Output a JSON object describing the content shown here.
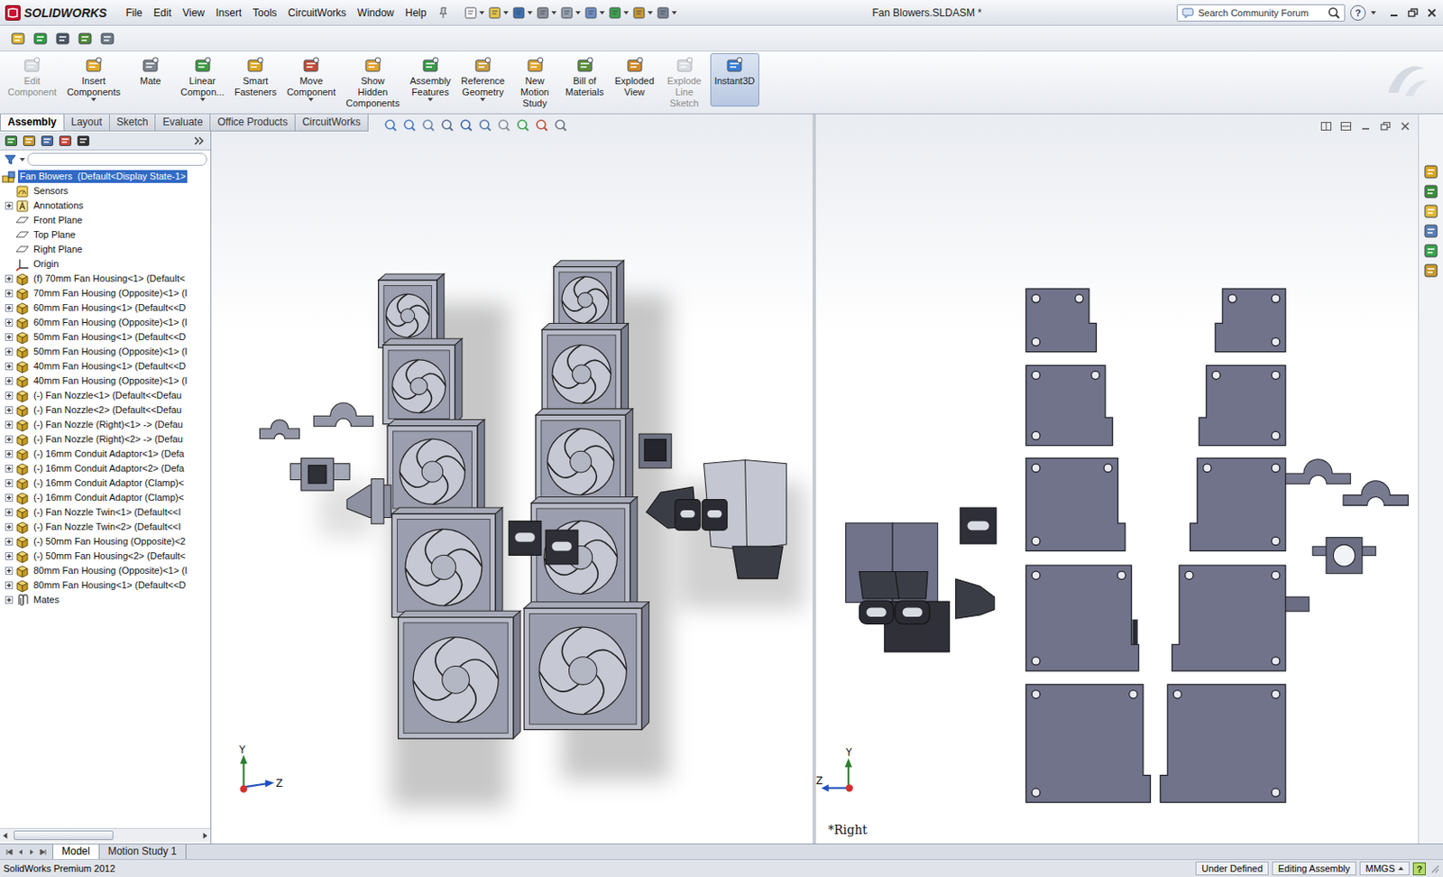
{
  "app": {
    "logo": "SOLIDWORKS",
    "title": "Fan Blowers.SLDASM *"
  },
  "menus": [
    "File",
    "Edit",
    "View",
    "Insert",
    "Tools",
    "CircuitWorks",
    "Window",
    "Help"
  ],
  "search": {
    "placeholder": "Search Community Forum"
  },
  "help": "?",
  "ribbon": [
    {
      "lines": [
        "Edit",
        "Component"
      ],
      "disabled": true,
      "selected": false,
      "dropdown": false
    },
    {
      "lines": [
        "Insert",
        "Components"
      ],
      "disabled": false,
      "selected": false,
      "dropdown": true
    },
    {
      "lines": [
        "Mate"
      ],
      "disabled": false,
      "selected": false,
      "dropdown": false
    },
    {
      "lines": [
        "Linear",
        "Compon..."
      ],
      "disabled": false,
      "selected": false,
      "dropdown": true
    },
    {
      "lines": [
        "Smart",
        "Fasteners"
      ],
      "disabled": false,
      "selected": false,
      "dropdown": false
    },
    {
      "lines": [
        "Move",
        "Component"
      ],
      "disabled": false,
      "selected": false,
      "dropdown": true
    },
    {
      "lines": [
        "Show",
        "Hidden",
        "Components"
      ],
      "disabled": false,
      "selected": false,
      "dropdown": false
    },
    {
      "lines": [
        "Assembly",
        "Features"
      ],
      "disabled": false,
      "selected": false,
      "dropdown": true
    },
    {
      "lines": [
        "Reference",
        "Geometry"
      ],
      "disabled": false,
      "selected": false,
      "dropdown": true
    },
    {
      "lines": [
        "New",
        "Motion",
        "Study"
      ],
      "disabled": false,
      "selected": false,
      "dropdown": false
    },
    {
      "lines": [
        "Bill of",
        "Materials"
      ],
      "disabled": false,
      "selected": false,
      "dropdown": false
    },
    {
      "lines": [
        "Exploded",
        "View"
      ],
      "disabled": false,
      "selected": false,
      "dropdown": false
    },
    {
      "lines": [
        "Explode",
        "Line",
        "Sketch"
      ],
      "disabled": true,
      "selected": false,
      "dropdown": false
    },
    {
      "lines": [
        "Instant3D"
      ],
      "disabled": false,
      "selected": true,
      "dropdown": false
    }
  ],
  "tabs": [
    {
      "label": "Assembly",
      "selected": true
    },
    {
      "label": "Layout",
      "selected": false
    },
    {
      "label": "Sketch",
      "selected": false
    },
    {
      "label": "Evaluate",
      "selected": false
    },
    {
      "label": "Office Products",
      "selected": false
    },
    {
      "label": "CircuitWorks",
      "selected": false
    }
  ],
  "tree": [
    {
      "label": "Fan Blowers  (Default<Display State-1>",
      "kind": "assembly",
      "expandable": false,
      "selected": true
    },
    {
      "label": "Sensors",
      "kind": "sensors",
      "expandable": false,
      "selected": false
    },
    {
      "label": "Annotations",
      "kind": "annotations",
      "expandable": true,
      "selected": false
    },
    {
      "label": "Front Plane",
      "kind": "plane",
      "expandable": false,
      "selected": false
    },
    {
      "label": "Top Plane",
      "kind": "plane",
      "expandable": false,
      "selected": false
    },
    {
      "label": "Right Plane",
      "kind": "plane",
      "expandable": false,
      "selected": false
    },
    {
      "label": "Origin",
      "kind": "origin",
      "expandable": false,
      "selected": false
    },
    {
      "label": "(f) 70mm Fan Housing<1> (Default<",
      "kind": "part",
      "expandable": true,
      "selected": false
    },
    {
      "label": "70mm Fan Housing (Opposite)<1> (I",
      "kind": "part",
      "expandable": true,
      "selected": false
    },
    {
      "label": "60mm Fan Housing<1> (Default<<D",
      "kind": "part",
      "expandable": true,
      "selected": false
    },
    {
      "label": "60mm Fan Housing (Opposite)<1> (I",
      "kind": "part",
      "expandable": true,
      "selected": false
    },
    {
      "label": "50mm Fan Housing<1> (Default<<D",
      "kind": "part",
      "expandable": true,
      "selected": false
    },
    {
      "label": "50mm Fan Housing (Opposite)<1> (I",
      "kind": "part",
      "expandable": true,
      "selected": false
    },
    {
      "label": "40mm Fan Housing<1> (Default<<D",
      "kind": "part",
      "expandable": true,
      "selected": false
    },
    {
      "label": "40mm Fan Housing (Opposite)<1> (I",
      "kind": "part",
      "expandable": true,
      "selected": false
    },
    {
      "label": "(-) Fan Nozzle<1> (Default<<Defau",
      "kind": "part",
      "expandable": true,
      "selected": false
    },
    {
      "label": "(-) Fan Nozzle<2> (Default<<Defau",
      "kind": "part",
      "expandable": true,
      "selected": false
    },
    {
      "label": "(-) Fan Nozzle (Right)<1> -> (Defau",
      "kind": "part",
      "expandable": true,
      "selected": false
    },
    {
      "label": "(-) Fan Nozzle (Right)<2> -> (Defau",
      "kind": "part",
      "expandable": true,
      "selected": false
    },
    {
      "label": "(-) 16mm Conduit Adaptor<1> (Defa",
      "kind": "part",
      "expandable": true,
      "selected": false
    },
    {
      "label": "(-) 16mm Conduit Adaptor<2> (Defa",
      "kind": "part",
      "expandable": true,
      "selected": false
    },
    {
      "label": "(-) 16mm Conduit Adaptor (Clamp)<",
      "kind": "part",
      "expandable": true,
      "selected": false
    },
    {
      "label": "(-) 16mm Conduit Adaptor (Clamp)<",
      "kind": "part",
      "expandable": true,
      "selected": false
    },
    {
      "label": "(-) Fan Nozzle Twin<1> (Default<<I",
      "kind": "part",
      "expandable": true,
      "selected": false
    },
    {
      "label": "(-) Fan Nozzle Twin<2> (Default<<I",
      "kind": "part",
      "expandable": true,
      "selected": false
    },
    {
      "label": "(-) 50mm Fan Housing (Opposite)<2",
      "kind": "part",
      "expandable": true,
      "selected": false
    },
    {
      "label": "(-) 50mm Fan Housing<2> (Default<",
      "kind": "part",
      "expandable": true,
      "selected": false
    },
    {
      "label": "80mm Fan Housing (Opposite)<1> (I",
      "kind": "part",
      "expandable": true,
      "selected": false
    },
    {
      "label": "80mm Fan Housing<1> (Default<<D",
      "kind": "part",
      "expandable": true,
      "selected": false
    },
    {
      "label": "Mates",
      "kind": "mates",
      "expandable": true,
      "selected": false
    }
  ],
  "views": {
    "left": {
      "triad_up": "Y",
      "triad_side": "Z"
    },
    "right": {
      "label": "*Right",
      "triad_up": "Y",
      "triad_side": "Z"
    }
  },
  "bottom_tabs": [
    {
      "label": "Model",
      "selected": true
    },
    {
      "label": "Motion Study 1",
      "selected": false
    }
  ],
  "status_bar": {
    "product": "SolidWorks Premium 2012",
    "fields": [
      "Under Defined",
      "Editing Assembly"
    ],
    "units": "MMGS",
    "help": "?"
  }
}
